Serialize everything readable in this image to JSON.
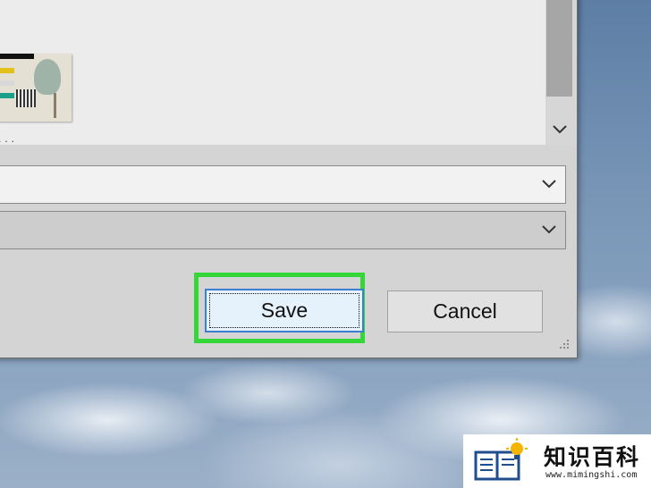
{
  "dialog": {
    "thumbnail_caption": "...",
    "buttons": {
      "save_label": "Save",
      "cancel_label": "Cancel"
    }
  },
  "watermark": {
    "title": "知识百科",
    "url": "www.mimingshi.com"
  },
  "colors": {
    "highlight": "#35d638",
    "save_button_bg": "#e5f1fb",
    "save_button_border": "#3c7fd0"
  },
  "icons": [
    "chevron-down-icon",
    "resize-grip-icon",
    "book-lightbulb-logo"
  ]
}
